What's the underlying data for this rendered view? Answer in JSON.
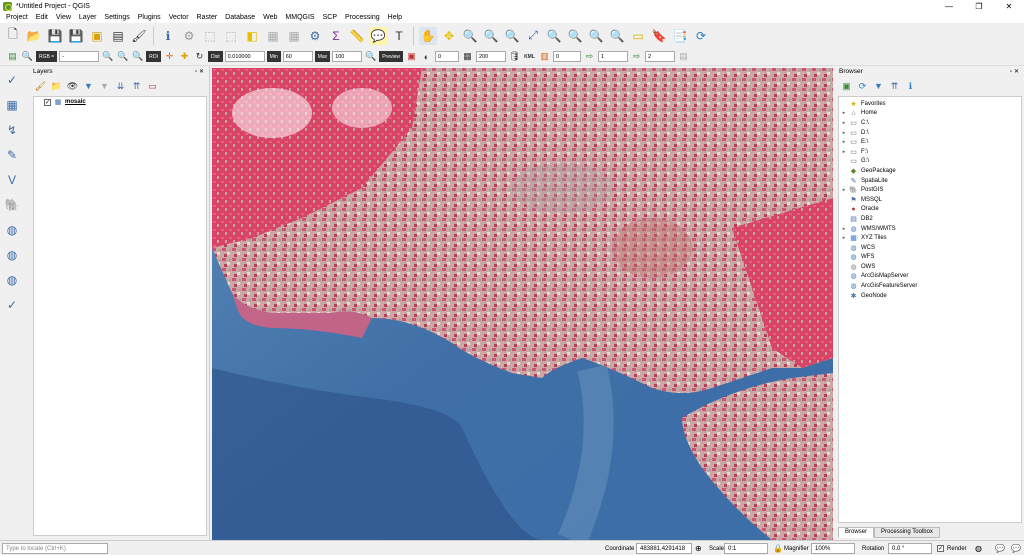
{
  "window": {
    "title": "*Untitled Project - QGIS",
    "minimize": "—",
    "maximize": "❐",
    "close": "✕"
  },
  "menu": [
    "Project",
    "Edit",
    "View",
    "Layer",
    "Settings",
    "Plugins",
    "Vector",
    "Raster",
    "Database",
    "Web",
    "MMQGIS",
    "SCP",
    "Processing",
    "Help"
  ],
  "scp": {
    "band_set": "RGB =",
    "rgb_value": "-",
    "roi": "ROI",
    "dist_label": "Dist",
    "dist_value": "0.010000",
    "min_label": "Min",
    "min_value": "60",
    "max_label": "Max",
    "max_value": "100",
    "preview": "Preview",
    "field1": "0",
    "field2": "200",
    "field3": "0",
    "field4": "1",
    "field5": "2"
  },
  "layers": {
    "title": "Layers",
    "items": [
      {
        "name": "mosaic",
        "checked": "✓"
      }
    ]
  },
  "browser": {
    "title": "Browser",
    "items": [
      {
        "label": "Favorites",
        "icon": "★",
        "color": "#e0b000",
        "expand": ""
      },
      {
        "label": "Home",
        "icon": "⌂",
        "color": "#666",
        "expand": "▸"
      },
      {
        "label": "C:\\",
        "icon": "▭",
        "color": "#666",
        "expand": "▸"
      },
      {
        "label": "D:\\",
        "icon": "▭",
        "color": "#666",
        "expand": "▸"
      },
      {
        "label": "E:\\",
        "icon": "▭",
        "color": "#666",
        "expand": "▸"
      },
      {
        "label": "F:\\",
        "icon": "▭",
        "color": "#666",
        "expand": "▸"
      },
      {
        "label": "G:\\",
        "icon": "▭",
        "color": "#666",
        "expand": ""
      },
      {
        "label": "GeoPackage",
        "icon": "◆",
        "color": "#5a8a2a",
        "expand": ""
      },
      {
        "label": "SpatiaLite",
        "icon": "✎",
        "color": "#3a6aa8",
        "expand": ""
      },
      {
        "label": "PostGIS",
        "icon": "🐘",
        "color": "#336791",
        "expand": "▸"
      },
      {
        "label": "MSSQL",
        "icon": "⚑",
        "color": "#4a6fa5",
        "expand": ""
      },
      {
        "label": "Oracle",
        "icon": "●",
        "color": "#c04040",
        "expand": ""
      },
      {
        "label": "DB2",
        "icon": "▤",
        "color": "#4a6fa5",
        "expand": ""
      },
      {
        "label": "WMS/WMTS",
        "icon": "◍",
        "color": "#3a7abf",
        "expand": "▸"
      },
      {
        "label": "XYZ Tiles",
        "icon": "▦",
        "color": "#3a7abf",
        "expand": "▸"
      },
      {
        "label": "WCS",
        "icon": "◍",
        "color": "#3a7abf",
        "expand": ""
      },
      {
        "label": "WFS",
        "icon": "◍",
        "color": "#3a7abf",
        "expand": ""
      },
      {
        "label": "OWS",
        "icon": "◍",
        "color": "#888",
        "expand": ""
      },
      {
        "label": "ArcGisMapServer",
        "icon": "◍",
        "color": "#3a7abf",
        "expand": ""
      },
      {
        "label": "ArcGisFeatureServer",
        "icon": "◍",
        "color": "#3a7abf",
        "expand": ""
      },
      {
        "label": "GeoNode",
        "icon": "✱",
        "color": "#3a7abf",
        "expand": ""
      }
    ],
    "tab_browser": "Browser",
    "tab_processing": "Processing Toolbox"
  },
  "status": {
    "locate_placeholder": "Type to locate (Ctrl+K)",
    "coordinate_label": "Coordinate",
    "coordinate": "483881,4291418",
    "scale_label": "Scale",
    "scale": "0:1",
    "magnifier_label": "Magnifier",
    "magnifier": "100%",
    "rotation_label": "Rotation",
    "rotation": "0.0 °",
    "render_label": "Render",
    "render_checked": "✓"
  }
}
